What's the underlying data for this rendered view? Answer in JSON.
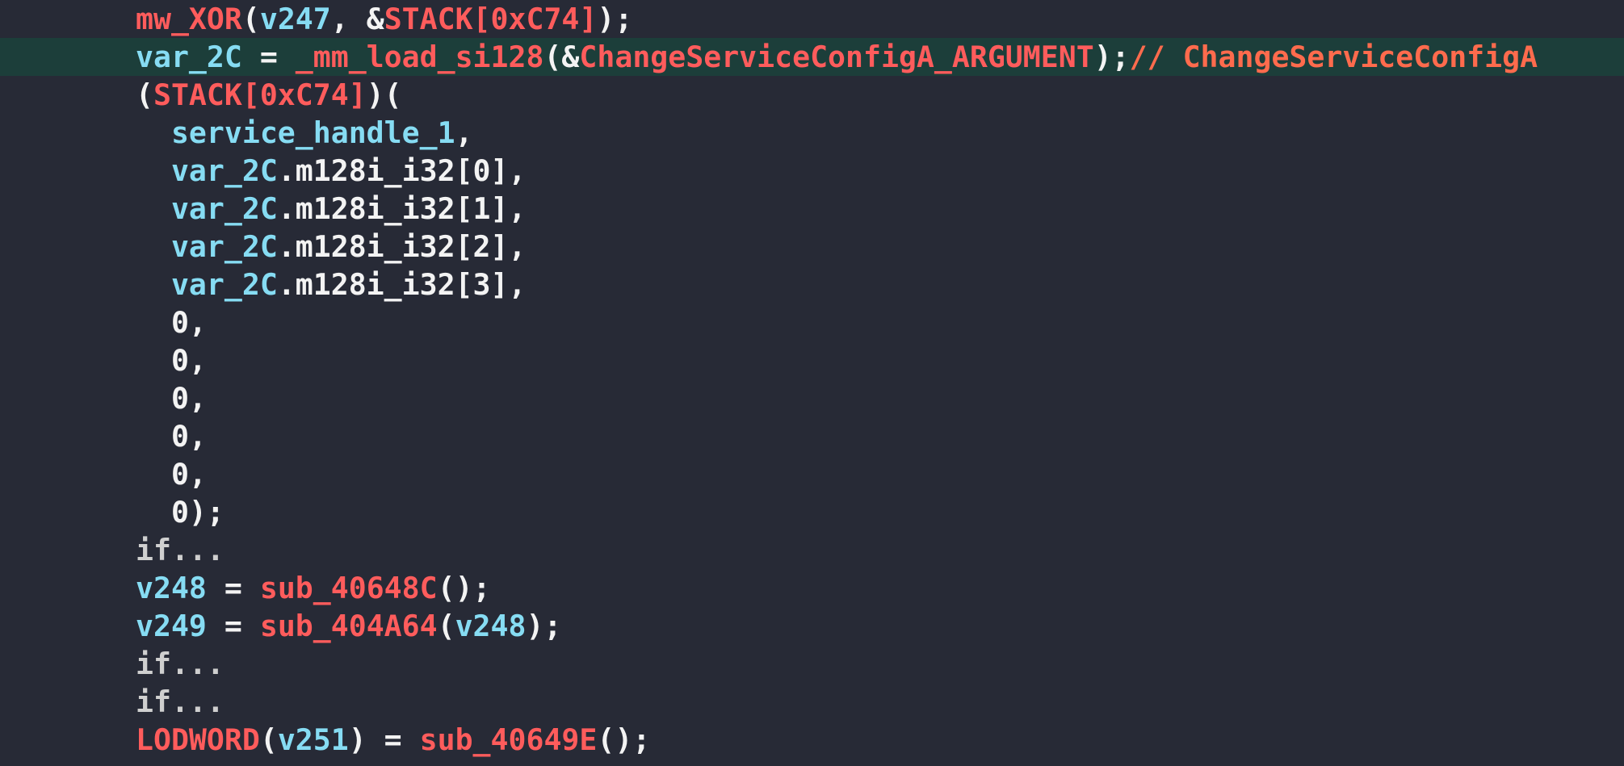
{
  "colors": {
    "background": "#272a36",
    "highlight_line": "#1c3e3a",
    "variable": "#86dcf3",
    "function": "#ff5c5c",
    "plain": "#f3f3f3",
    "comment": "#ff6b4d",
    "collapsed": "#cfcfcf"
  },
  "lines": [
    {
      "highlighted": false,
      "tokens": [
        {
          "t": "mw_XOR",
          "k": "fn"
        },
        {
          "t": "(",
          "k": "plain"
        },
        {
          "t": "v247",
          "k": "var"
        },
        {
          "t": ", &",
          "k": "plain"
        },
        {
          "t": "STACK[0xC74]",
          "k": "fn"
        },
        {
          "t": ");",
          "k": "plain"
        }
      ]
    },
    {
      "highlighted": true,
      "tokens": [
        {
          "t": "var_2C",
          "k": "var"
        },
        {
          "t": " = ",
          "k": "plain"
        },
        {
          "t": "_mm_load_si128",
          "k": "fn"
        },
        {
          "t": "(&",
          "k": "plain"
        },
        {
          "t": "ChangeServiceConfigA_ARGUMENT",
          "k": "fn"
        },
        {
          "t": ");",
          "k": "plain"
        },
        {
          "t": "// ChangeServiceConfigA",
          "k": "comment"
        }
      ]
    },
    {
      "highlighted": false,
      "tokens": [
        {
          "t": "(",
          "k": "plain"
        },
        {
          "t": "STACK[0xC74]",
          "k": "fn"
        },
        {
          "t": ")(",
          "k": "plain"
        }
      ]
    },
    {
      "highlighted": false,
      "tokens": [
        {
          "t": "  ",
          "k": "plain"
        },
        {
          "t": "service_handle_1",
          "k": "var"
        },
        {
          "t": ",",
          "k": "plain"
        }
      ]
    },
    {
      "highlighted": false,
      "tokens": [
        {
          "t": "  ",
          "k": "plain"
        },
        {
          "t": "var_2C",
          "k": "var"
        },
        {
          "t": ".m128i_i32[0],",
          "k": "plain"
        }
      ]
    },
    {
      "highlighted": false,
      "tokens": [
        {
          "t": "  ",
          "k": "plain"
        },
        {
          "t": "var_2C",
          "k": "var"
        },
        {
          "t": ".m128i_i32[1],",
          "k": "plain"
        }
      ]
    },
    {
      "highlighted": false,
      "tokens": [
        {
          "t": "  ",
          "k": "plain"
        },
        {
          "t": "var_2C",
          "k": "var"
        },
        {
          "t": ".m128i_i32[2],",
          "k": "plain"
        }
      ]
    },
    {
      "highlighted": false,
      "tokens": [
        {
          "t": "  ",
          "k": "plain"
        },
        {
          "t": "var_2C",
          "k": "var"
        },
        {
          "t": ".m128i_i32[3],",
          "k": "plain"
        }
      ]
    },
    {
      "highlighted": false,
      "tokens": [
        {
          "t": "  0,",
          "k": "plain"
        }
      ]
    },
    {
      "highlighted": false,
      "tokens": [
        {
          "t": "  0,",
          "k": "plain"
        }
      ]
    },
    {
      "highlighted": false,
      "tokens": [
        {
          "t": "  0,",
          "k": "plain"
        }
      ]
    },
    {
      "highlighted": false,
      "tokens": [
        {
          "t": "  0,",
          "k": "plain"
        }
      ]
    },
    {
      "highlighted": false,
      "tokens": [
        {
          "t": "  0,",
          "k": "plain"
        }
      ]
    },
    {
      "highlighted": false,
      "tokens": [
        {
          "t": "  0);",
          "k": "plain"
        }
      ]
    },
    {
      "highlighted": false,
      "tokens": [
        {
          "t": "if...",
          "k": "collapsed"
        }
      ]
    },
    {
      "highlighted": false,
      "tokens": [
        {
          "t": "v248",
          "k": "var"
        },
        {
          "t": " = ",
          "k": "plain"
        },
        {
          "t": "sub_40648C",
          "k": "fn"
        },
        {
          "t": "();",
          "k": "plain"
        }
      ]
    },
    {
      "highlighted": false,
      "tokens": [
        {
          "t": "v249",
          "k": "var"
        },
        {
          "t": " = ",
          "k": "plain"
        },
        {
          "t": "sub_404A64",
          "k": "fn"
        },
        {
          "t": "(",
          "k": "plain"
        },
        {
          "t": "v248",
          "k": "var"
        },
        {
          "t": ");",
          "k": "plain"
        }
      ]
    },
    {
      "highlighted": false,
      "tokens": [
        {
          "t": "if...",
          "k": "collapsed"
        }
      ]
    },
    {
      "highlighted": false,
      "tokens": [
        {
          "t": "if...",
          "k": "collapsed"
        }
      ]
    },
    {
      "highlighted": false,
      "tokens": [
        {
          "t": "LODWORD",
          "k": "fn"
        },
        {
          "t": "(",
          "k": "plain"
        },
        {
          "t": "v251",
          "k": "var"
        },
        {
          "t": ") = ",
          "k": "plain"
        },
        {
          "t": "sub_40649E",
          "k": "fn"
        },
        {
          "t": "();",
          "k": "plain"
        }
      ]
    }
  ]
}
